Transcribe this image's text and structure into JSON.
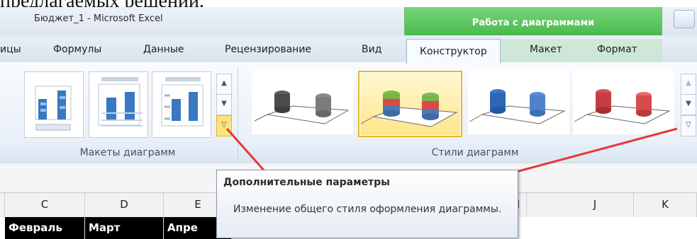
{
  "document": {
    "partial_text": "предлагаемых решений."
  },
  "window": {
    "title": "Бюджет_1  -  Microsoft Excel",
    "context_tab_group": "Работа с диаграммами"
  },
  "ribbon": {
    "tabs": [
      {
        "label": "ицы"
      },
      {
        "label": "Формулы"
      },
      {
        "label": "Данные"
      },
      {
        "label": "Рецензирование"
      },
      {
        "label": "Вид"
      },
      {
        "label": "Конструктор",
        "active": true
      },
      {
        "label": "Макет"
      },
      {
        "label": "Формат"
      }
    ],
    "groups": {
      "layouts_label": "Макеты диаграмм",
      "styles_label": "Стили диаграмм"
    },
    "chart_styles": [
      {
        "name": "gray-cylinder-style",
        "colors": [
          "#4b4b4b",
          "#7b7b7b"
        ]
      },
      {
        "name": "multicolor-cylinder-style",
        "colors": [
          "#4f78b8",
          "#d94a43",
          "#79b34b"
        ],
        "selected": true
      },
      {
        "name": "blue-cylinder-style",
        "colors": [
          "#2e67b5",
          "#5a8ad1"
        ]
      },
      {
        "name": "red-cylinder-style",
        "colors": [
          "#c83c40",
          "#e45b5d"
        ]
      }
    ]
  },
  "tooltip": {
    "title": "Дополнительные параметры",
    "description": "Изменение общего стиля оформления диаграммы."
  },
  "sheet": {
    "columns": [
      "C",
      "D",
      "E",
      "I",
      "J",
      "K"
    ],
    "row_values": [
      "Февраль",
      "Март",
      "Апре"
    ]
  },
  "colors": {
    "context_green": "#4cbc4f",
    "selected_style": "#e4b82b",
    "annotation_red": "#e53935"
  }
}
